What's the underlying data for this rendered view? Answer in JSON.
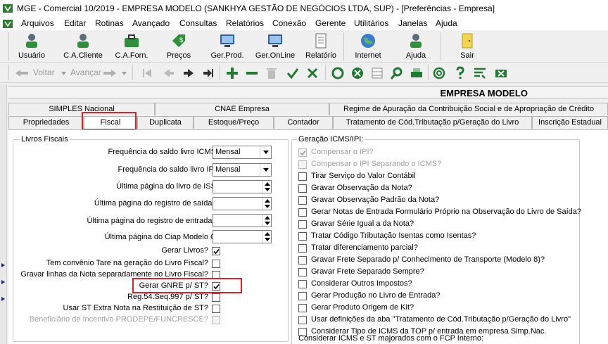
{
  "window": {
    "title": "MGE - Comercial 10/2019 - EMPRESA MODELO (SANKHYA GESTÃO DE NEGÓCIOS LTDA, SUP) - [Preferências - Empresa]"
  },
  "menu": {
    "items": [
      "Arquivos",
      "Editar",
      "Rotinas",
      "Avançado",
      "Consultas",
      "Relatórios",
      "Conexão",
      "Gerente",
      "Utilitários",
      "Janelas",
      "Ajuda"
    ]
  },
  "toolbar": {
    "buttons": [
      {
        "label": "Usuário",
        "icon": "user-icon"
      },
      {
        "label": "C.A.Cliente",
        "icon": "client-icon"
      },
      {
        "label": "C.A.Forn.",
        "icon": "supplier-icon"
      },
      {
        "label": "Preços",
        "icon": "price-tag-icon"
      },
      {
        "label": "Ger.Prod.",
        "icon": "product-manager-icon"
      },
      {
        "label": "Ger.OnLine",
        "icon": "online-manager-icon"
      },
      {
        "label": "Relatório",
        "icon": "report-icon"
      },
      {
        "label": "Internet",
        "icon": "globe-icon"
      },
      {
        "label": "Ajuda",
        "icon": "help-icon"
      },
      {
        "label": "Sair",
        "icon": "exit-icon"
      }
    ]
  },
  "toolbar2": {
    "back_label": "Voltar",
    "forward_label": "Avançar"
  },
  "company": {
    "name": "EMPRESA MODELO"
  },
  "tabs": {
    "row1": [
      "SIMPLES Nacional",
      "CNAE Empresa",
      "Regime de Apuração da Contribuição Social e de Apropriação de Crédito"
    ],
    "row2": [
      "Propriedades",
      "Fiscal",
      "Duplicata",
      "Estoque/Preço",
      "Contador",
      "Tratamento de Cód.Tributação p/Geração do Livro",
      "Inscrição Estadual"
    ]
  },
  "livros": {
    "title": "Livros Fiscais",
    "freq_icms_label": "Frequência do saldo livro ICMS:",
    "freq_icms_value": "Mensal",
    "freq_ipi_label": "Frequência do saldo livro IPI:",
    "freq_ipi_value": "Mensal",
    "ult_iss_label": "Última página do livro de ISS:",
    "ult_saidas_label": "Última página do registro de saídas:",
    "ult_entradas_label": "Última página do registro de entradas:",
    "ult_ciap_label": "Última página do Ciap Modelo C:",
    "checks": [
      {
        "label": "Gerar Livros?",
        "checked": true,
        "disabled": false
      },
      {
        "label": "Tem convênio Tare na geração do Livro Fiscal?",
        "checked": false,
        "disabled": false
      },
      {
        "label": "Gravar linhas da Nota separadamente no Livro Fiscal?",
        "checked": false,
        "disabled": false
      },
      {
        "label": "Gerar GNRE p/ ST?",
        "checked": true,
        "disabled": false
      },
      {
        "label": "Reg.54.Seq.997 p/ ST?",
        "checked": false,
        "disabled": false
      },
      {
        "label": "Usar ST Extra Nota na Restituição de ST?",
        "checked": false,
        "disabled": false
      },
      {
        "label": "Beneficiário de Incentivo PRODEPE/FUNCRESCE?",
        "checked": false,
        "disabled": true
      }
    ]
  },
  "icms": {
    "title": "Geração ICMS/IPI:",
    "checks": [
      {
        "label": "Compensar o IPI?",
        "checked": true,
        "disabled": true
      },
      {
        "label": "Compensar o IPI Separando o ICMS?",
        "checked": false,
        "disabled": true
      },
      {
        "label": "Tirar Serviço do Valor Contábil",
        "checked": false,
        "disabled": false
      },
      {
        "label": "Gravar Observação da Nota?",
        "checked": false,
        "disabled": false
      },
      {
        "label": "Gravar Observação Padrão da Nota?",
        "checked": false,
        "disabled": false
      },
      {
        "label": "Gerar Notas de Entrada Formulário Próprio na Observação do Livro de Saída?",
        "checked": false,
        "disabled": false
      },
      {
        "label": "Gravar Série Igual a da Nota?",
        "checked": false,
        "disabled": false
      },
      {
        "label": "Tratar Código Tributação Isentas como Isentas?",
        "checked": false,
        "disabled": false
      },
      {
        "label": "Tratar diferenciamento parcial?",
        "checked": false,
        "disabled": false
      },
      {
        "label": "Gravar Frete Separado p/ Conhecimento de Transporte (Modelo 8)?",
        "checked": false,
        "disabled": false
      },
      {
        "label": "Gravar Frete Separado Sempre?",
        "checked": false,
        "disabled": false
      },
      {
        "label": "Considerar Outros Impostos?",
        "checked": false,
        "disabled": false
      },
      {
        "label": "Gerar Produção no Livro de Entrada?",
        "checked": false,
        "disabled": false
      },
      {
        "label": "Gerar Produto Origem de Kit?",
        "checked": false,
        "disabled": false
      },
      {
        "label": "Usar definições da aba \"Tratamento de Cód.Tributação p/Geração do Livro\"",
        "checked": false,
        "disabled": false
      },
      {
        "label": "Considerar Tipo de ICMS da TOP p/ entrada em empresa Simp.Nac.",
        "checked": false,
        "disabled": false
      }
    ],
    "fcp_label": "Considerar ICMS e ST majorados com o FCP Interno:"
  }
}
